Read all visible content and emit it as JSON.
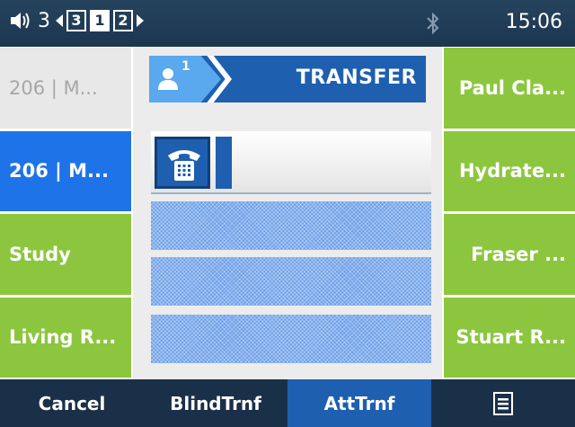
{
  "status_bar": {
    "volume_icon": "speaker-icon",
    "line_number": "3",
    "pages": [
      "3",
      "1",
      "2"
    ],
    "active_page": "1",
    "bluetooth_icon": "bluetooth-icon",
    "time": "15:06"
  },
  "left_keys": [
    {
      "label": "206 | M...",
      "state": "grey"
    },
    {
      "label": "206 | M...",
      "state": "blue"
    },
    {
      "label": "Study",
      "state": "green"
    },
    {
      "label": "Living R...",
      "state": "green"
    }
  ],
  "right_keys": [
    {
      "label": "Paul Cla...",
      "state": "green"
    },
    {
      "label": "Hydrate...",
      "state": "green"
    },
    {
      "label": "Fraser ...",
      "state": "green"
    },
    {
      "label": "Stuart R...",
      "state": "green"
    }
  ],
  "center": {
    "mode_title": "TRANSFER",
    "line_badge": "1",
    "person_icon": "person-icon",
    "phone_icon": "desk-phone-icon"
  },
  "softkeys": [
    {
      "label": "Cancel",
      "active": false
    },
    {
      "label": "BlindTrnf",
      "active": false
    },
    {
      "label": "AttTrnf",
      "active": true
    }
  ],
  "menu_icon": "menu-list-icon",
  "colors": {
    "accent_blue": "#1e73e8",
    "dark_blue": "#1e5fb0",
    "green": "#8cc63e",
    "status_bg": "#1c3650"
  }
}
